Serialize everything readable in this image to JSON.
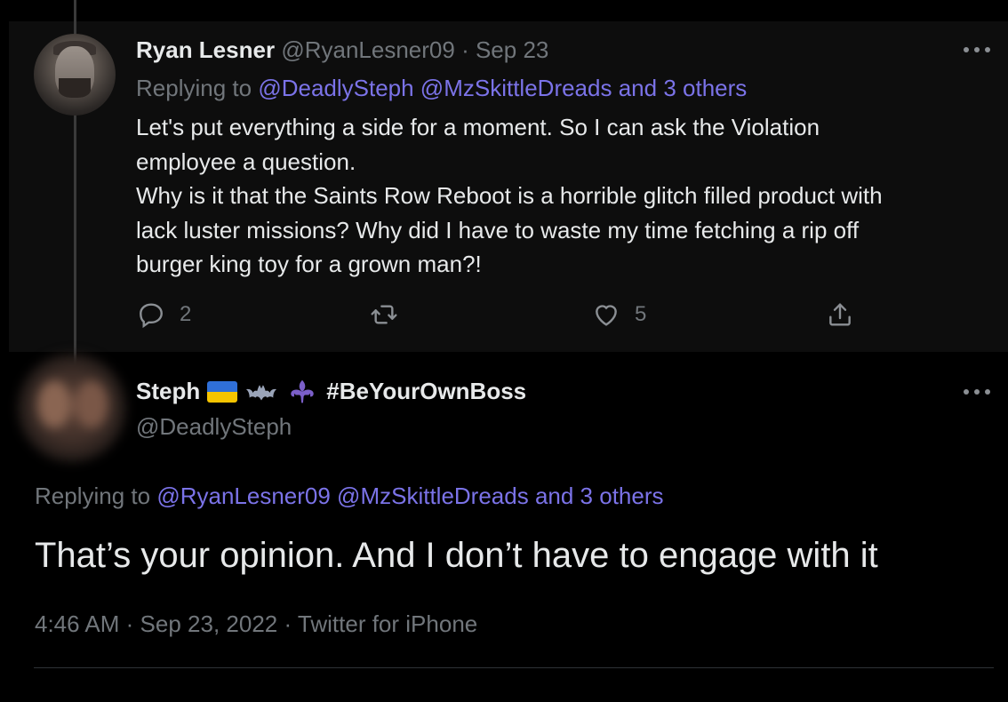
{
  "colors": {
    "background": "#000000",
    "card": "#0d0d0d",
    "text": "#e7e9ea",
    "muted": "#71767b",
    "mention": "#7b73e8"
  },
  "parent_tweet": {
    "author_name": "Ryan Lesner",
    "author_handle": "@RyanLesner09",
    "separator": "·",
    "date": "Sep 23",
    "replying_to_label": "Replying to",
    "replying_mentions": "@DeadlySteph @MzSkittleDreads",
    "replying_others": "and 3 others",
    "body_lines": [
      "Let's put everything a side for a moment. So I can ask the Violation",
      "employee a question.",
      "Why is it that the Saints Row Reboot is a horrible glitch filled product with",
      "lack luster missions? Why did I have to waste my time fetching a rip off",
      "burger king toy for a grown man?!"
    ],
    "reply_count": "2",
    "retweet_count": "",
    "like_count": "5",
    "icons": [
      "reply-icon",
      "retweet-icon",
      "like-icon",
      "share-icon",
      "more-icon"
    ]
  },
  "main_tweet": {
    "author_name": "Steph",
    "hashtag": "#BeYourOwnBoss",
    "name_emoji": [
      "ukraine-flag-icon",
      "bat-icon",
      "fleur-de-lis-icon"
    ],
    "author_handle": "@DeadlySteph",
    "replying_to_label": "Replying to",
    "replying_mentions": "@RyanLesner09 @MzSkittleDreads",
    "replying_others": "and 3 others",
    "body": "That’s your opinion. And I don’t have to engage with it",
    "time": "4:46 AM",
    "separator": "·",
    "date": "Sep 23, 2022",
    "source": "Twitter for iPhone"
  }
}
